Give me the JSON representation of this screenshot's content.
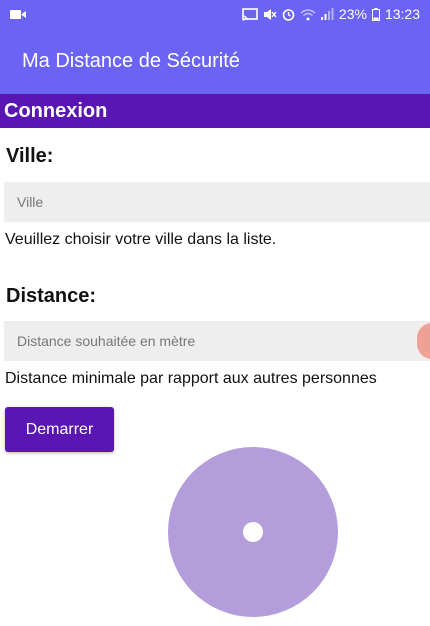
{
  "status_bar": {
    "battery": "23%",
    "time": "13:23",
    "icons": [
      "video-camera-icon",
      "cast-icon",
      "mute-icon",
      "alarm-icon",
      "wifi-icon",
      "signal-icon",
      "battery-icon"
    ]
  },
  "app_bar": {
    "title": "Ma Distance de Sécurité"
  },
  "section": {
    "title": "Connexion"
  },
  "ville": {
    "label": "Ville:",
    "placeholder": "Ville",
    "help": "Veuillez choisir votre ville dans la liste."
  },
  "distance": {
    "label": "Distance:",
    "placeholder": "Distance souhaitée en mètre",
    "help": "Distance minimale par rapport aux autres personnes"
  },
  "start_button": {
    "label": "Demarrer"
  },
  "colors": {
    "app_bar": "#6a63f3",
    "section_bar": "#5a16b3",
    "button": "#5a16b3",
    "disc": "#b39ddb",
    "edge_bubble": "#f0a196"
  }
}
